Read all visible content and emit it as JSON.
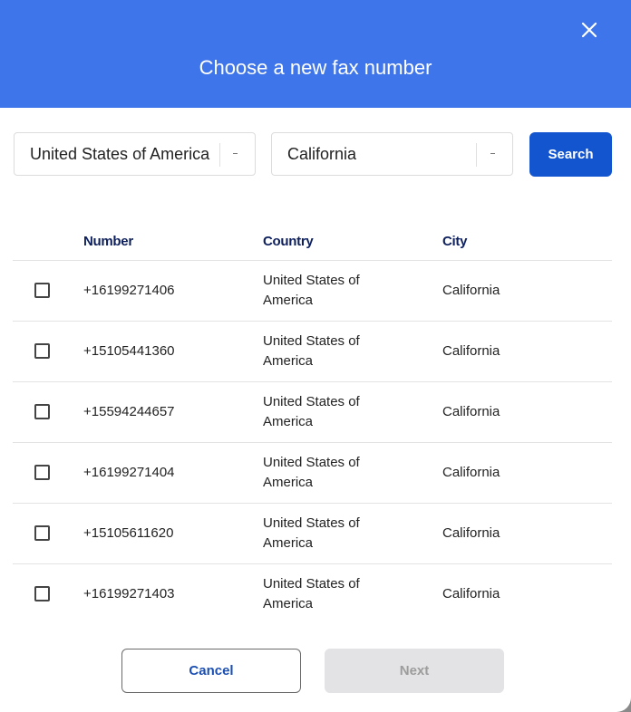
{
  "dialog": {
    "title": "Choose a new fax number",
    "close_icon": "close-icon"
  },
  "filters": {
    "country": {
      "value": "United States of America"
    },
    "region": {
      "value": "California"
    },
    "search_label": "Search"
  },
  "table": {
    "headers": {
      "number": "Number",
      "country": "Country",
      "city": "City"
    },
    "rows": [
      {
        "number": "+16199271406",
        "country": "United States of America",
        "city": "California",
        "checked": false
      },
      {
        "number": "+15105441360",
        "country": "United States of America",
        "city": "California",
        "checked": false
      },
      {
        "number": "+15594244657",
        "country": "United States of America",
        "city": "California",
        "checked": false
      },
      {
        "number": "+16199271404",
        "country": "United States of America",
        "city": "California",
        "checked": false
      },
      {
        "number": "+15105611620",
        "country": "United States of America",
        "city": "California",
        "checked": false
      },
      {
        "number": "+16199271403",
        "country": "United States of America",
        "city": "California",
        "checked": false
      }
    ]
  },
  "footer": {
    "cancel_label": "Cancel",
    "next_label": "Next",
    "next_disabled": true
  },
  "colors": {
    "header_bg": "#3f75ea",
    "primary": "#1255cf",
    "heading_text": "#0d1f5c"
  }
}
